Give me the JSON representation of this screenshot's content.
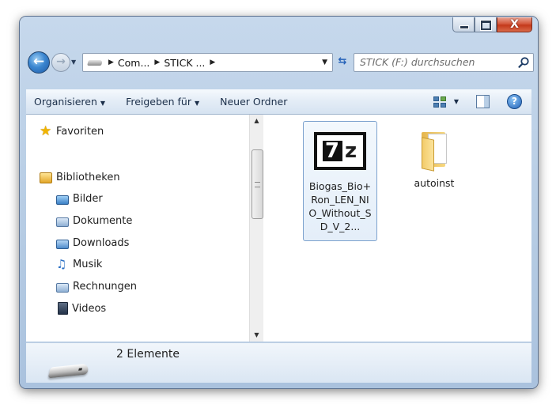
{
  "window": {
    "minimize_label": "_",
    "maximize_label": "",
    "close_label": "X"
  },
  "navigation": {
    "breadcrumbs": [
      "Com...",
      "STICK ..."
    ],
    "search_placeholder": "STICK (F:) durchsuchen"
  },
  "toolbar": {
    "organize": "Organisieren",
    "share": "Freigeben für",
    "new_folder": "Neuer Ordner"
  },
  "nav_pane": {
    "favorites": "Favoriten",
    "libraries": "Bibliotheken",
    "library_items": [
      "Bilder",
      "Dokumente",
      "Downloads",
      "Musik",
      "Rechnungen",
      "Videos"
    ]
  },
  "files": [
    {
      "name": "Biogas_Bio+Ron_LEN_NIO_Without_SD_V_2...",
      "type": "7z-archive",
      "selected": true
    },
    {
      "name": "autoinst",
      "type": "folder",
      "selected": false
    }
  ],
  "details": {
    "item_count": "2 Elemente"
  },
  "colors": {
    "frame": "#b5cbe3",
    "toolbar_text": "#1b2f4a",
    "selection_border": "#7da2ce",
    "close_button": "#c4391b"
  },
  "icons": [
    "back-icon",
    "forward-icon",
    "drive-icon",
    "refresh-icon",
    "search-icon",
    "views-icon",
    "preview-pane-icon",
    "help-icon",
    "star-icon",
    "library-icon",
    "pictures-icon",
    "documents-icon",
    "downloads-icon",
    "music-icon",
    "videos-icon",
    "7z-icon",
    "folder-icon"
  ]
}
